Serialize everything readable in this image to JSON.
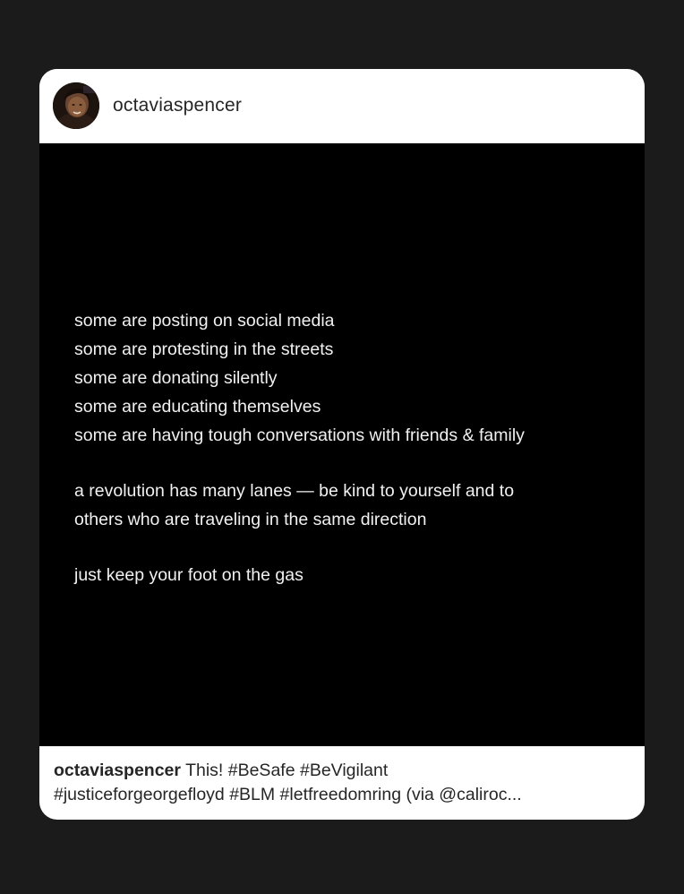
{
  "post": {
    "username": "octaviaspencer",
    "image_text": {
      "lines": [
        "some are posting on social media",
        "some are protesting in the streets",
        "some are donating silently",
        "some are educating themselves",
        "some are having tough conversations with friends & family"
      ],
      "paragraph2": [
        "a revolution has many lanes — be kind to yourself and to",
        "others who are traveling in the same direction"
      ],
      "closing": "just keep your foot on the gas"
    },
    "caption": {
      "username": "octaviaspencer",
      "line1": " This! #BeSafe #BeVigilant",
      "line2": "#justiceforgeorgefloyd #BLM #letfreedomring (via @caliroc..."
    }
  },
  "icons": {
    "avatar": "profile-photo"
  },
  "colors": {
    "page_background": "#1b1b1b",
    "card_background": "#ffffff",
    "image_background": "#000000",
    "image_text": "#f1f1f1",
    "text": "#262626"
  }
}
